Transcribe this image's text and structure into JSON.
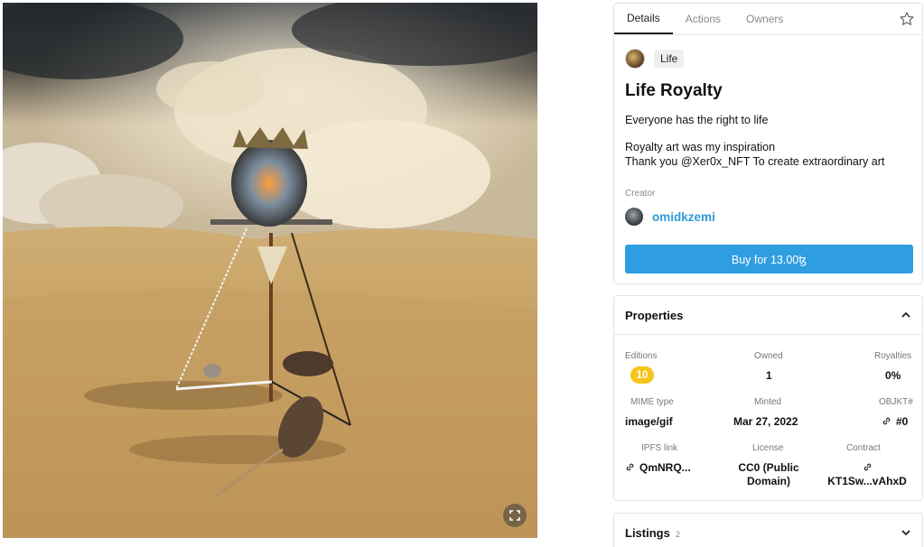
{
  "tabs": [
    {
      "label": "Details",
      "active": true
    },
    {
      "label": "Actions",
      "active": false
    },
    {
      "label": "Owners",
      "active": false
    }
  ],
  "icons": {
    "star": "star-icon",
    "fullscreen": "fullscreen-icon",
    "chevron_up": "chevron-up-icon",
    "chevron_down": "chevron-down-icon",
    "link": "link-icon"
  },
  "tag": "Life",
  "title": "Life Royalty",
  "description": [
    "Everyone has the right to life",
    "Royalty art was my inspiration",
    "Thank you @Xer0x_NFT To create extraordinary art"
  ],
  "creator": {
    "label": "Creator",
    "name": "omidkzemi"
  },
  "buy_button": "Buy for 13.00ꜩ",
  "properties": {
    "title": "Properties",
    "editions": {
      "label": "Editions",
      "value": "10"
    },
    "owned": {
      "label": "Owned",
      "value": "1"
    },
    "royalties": {
      "label": "Royalties",
      "value": "0%"
    },
    "mime": {
      "label": "MIME type",
      "value": "image/gif"
    },
    "minted": {
      "label": "Minted",
      "value": "Mar 27, 2022"
    },
    "objkt": {
      "label": "OBJKT#",
      "value": "#0"
    },
    "ipfs": {
      "label": "IPFS link",
      "value": "QmNRQ..."
    },
    "license": {
      "label": "License",
      "value_line1": "CC0 (Public",
      "value_line2": "Domain)"
    },
    "contract": {
      "label": "Contract",
      "value": "KT1Sw...vAhxD"
    }
  },
  "listings": {
    "title": "Listings",
    "count": "2"
  },
  "colors": {
    "accent": "#2f9ee0",
    "link": "#2d9bd7",
    "editions_badge": "#f5c518"
  }
}
